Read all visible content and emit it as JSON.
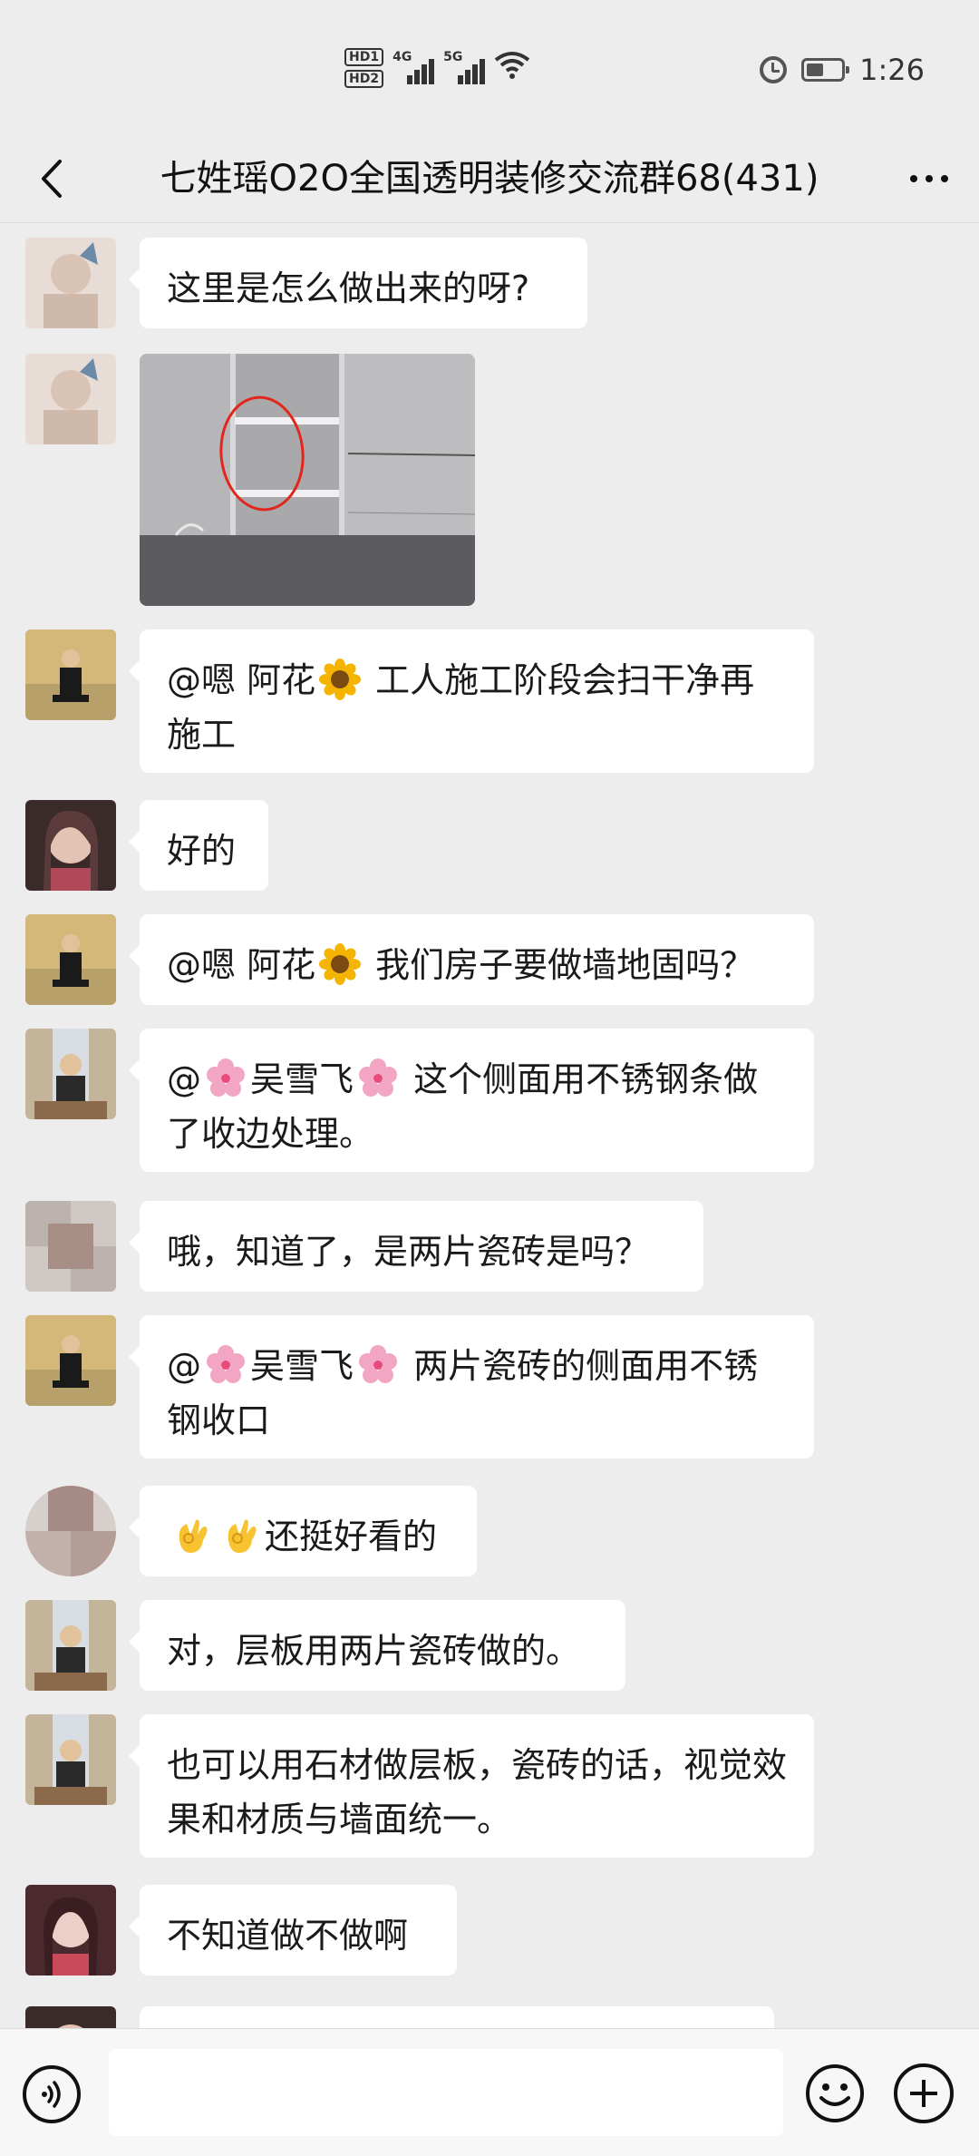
{
  "status_bar": {
    "hd1": "HD1",
    "hd2": "HD2",
    "sig1": "4G",
    "sig2": "5G",
    "wifi_icon": "wifi-icon",
    "alarm_icon": "alarm-icon",
    "battery_level": 0.5,
    "time": "1:26"
  },
  "header": {
    "title": "七姓瑶O2O全国透明装修交流群68(431)",
    "back_icon": "back-arrow-icon",
    "more_icon": "more-dots-icon"
  },
  "messages": [
    {
      "type": "text",
      "avatar": "avatar-blurred-woman-1",
      "text": "这里是怎么做出来的呀?"
    },
    {
      "type": "image",
      "avatar": "avatar-blurred-woman-1",
      "image": "bathroom-niche-photo"
    },
    {
      "type": "text",
      "avatar": "avatar-man-suit",
      "prefix": "@嗯 阿花",
      "emoji": "sunflower",
      "text": " 工人施工阶段会扫干净再施工"
    },
    {
      "type": "text",
      "avatar": "avatar-woman-portrait",
      "text": "好的"
    },
    {
      "type": "text",
      "avatar": "avatar-man-suit",
      "prefix": "@嗯 阿花",
      "emoji": "sunflower",
      "text": " 我们房子要做墙地固吗？"
    },
    {
      "type": "text",
      "avatar": "avatar-man-office",
      "prefix": "@",
      "name": "吴雪飞",
      "emoji": "blossom",
      "text": " 这个侧面用不锈钢条做了收边处理。"
    },
    {
      "type": "text",
      "avatar": "avatar-pixelated",
      "text": "哦，知道了，是两片瓷砖是吗？"
    },
    {
      "type": "text",
      "avatar": "avatar-man-suit",
      "prefix": "@",
      "name": "吴雪飞",
      "emoji": "blossom",
      "text": " 两片瓷砖的侧面用不锈钢收口"
    },
    {
      "type": "text",
      "avatar": "avatar-pixelated-2",
      "emoji": "ok-hand",
      "text": "还挺好看的"
    },
    {
      "type": "text",
      "avatar": "avatar-man-office",
      "text": "对，层板用两片瓷砖做的。"
    },
    {
      "type": "text",
      "avatar": "avatar-man-office",
      "text": "也可以用石材做层板，瓷砖的话，视觉效果和材质与墙面统一。"
    },
    {
      "type": "text",
      "avatar": "avatar-woman-portrait-2",
      "text": "不知道做不做啊"
    }
  ],
  "input_bar": {
    "voice_icon": "voice-icon",
    "input_value": "",
    "emoji_icon": "smiley-icon",
    "plus_icon": "plus-icon"
  }
}
